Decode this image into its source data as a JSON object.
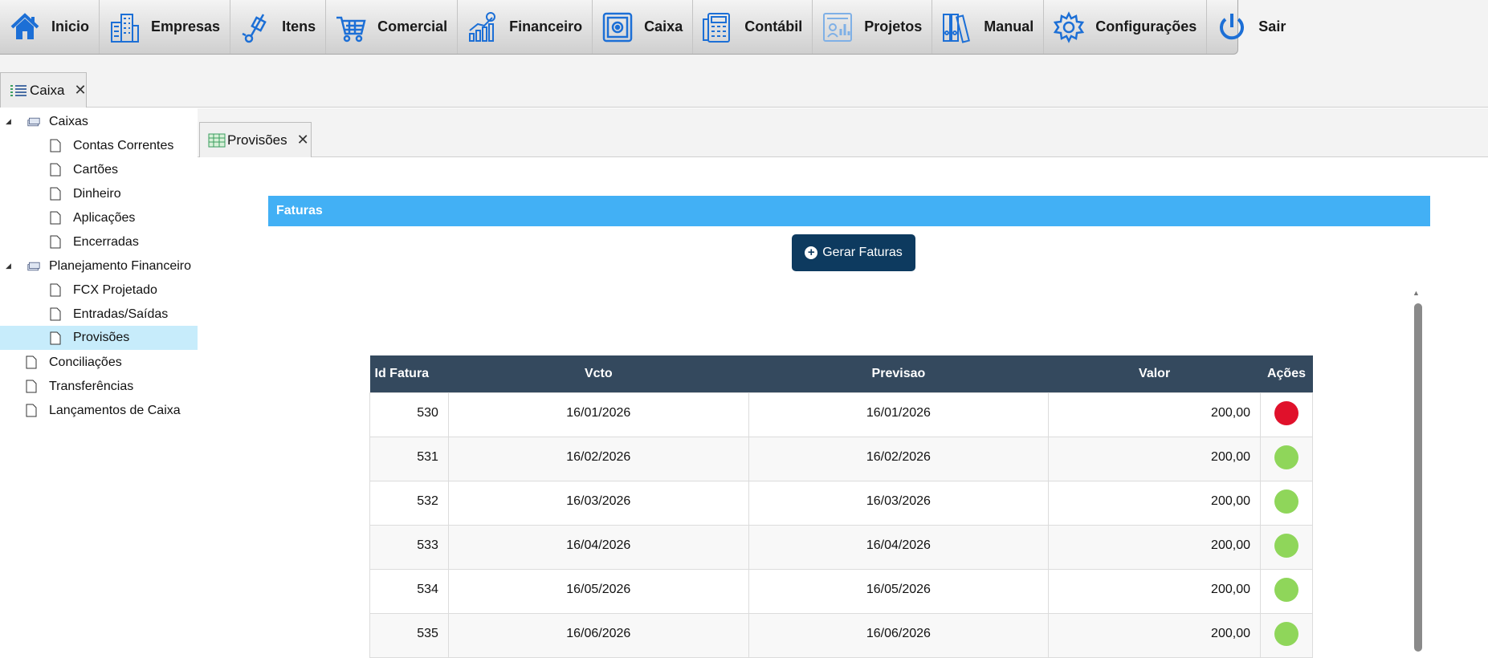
{
  "menu": {
    "items": [
      {
        "label": "Inicio",
        "icon": "home-icon"
      },
      {
        "label": "Empresas",
        "icon": "buildings-icon"
      },
      {
        "label": "Itens",
        "icon": "hand-truck-icon"
      },
      {
        "label": "Comercial",
        "icon": "shopping-cart-icon"
      },
      {
        "label": "Financeiro",
        "icon": "finance-chart-icon"
      },
      {
        "label": "Caixa",
        "icon": "safe-icon"
      },
      {
        "label": "Contábil",
        "icon": "calculator-icon"
      },
      {
        "label": "Projetos",
        "icon": "project-board-icon"
      },
      {
        "label": "Manual",
        "icon": "binders-icon"
      },
      {
        "label": "Configurações",
        "icon": "gear-icon"
      },
      {
        "label": "Sair",
        "icon": "power-icon"
      }
    ]
  },
  "outer_tab": {
    "label": "Caixa"
  },
  "tree": {
    "caixas": "Caixas",
    "contas_correntes": "Contas Correntes",
    "cartoes": "Cartões",
    "dinheiro": "Dinheiro",
    "aplicacoes": "Aplicações",
    "encerradas": "Encerradas",
    "planejamento": "Planejamento Financeiro",
    "fcx": "FCX Projetado",
    "entradas": "Entradas/Saídas",
    "provisoes": "Provisões",
    "conciliacoes": "Conciliações",
    "transferencias": "Transferências",
    "lancamentos": "Lançamentos de Caixa"
  },
  "inner_tab": {
    "label": "Provisões"
  },
  "faturas": {
    "title": "Faturas",
    "button": "Gerar Faturas",
    "columns": [
      "Id Fatura",
      "Vcto",
      "Previsao",
      "Valor",
      "Ações"
    ],
    "rows": [
      {
        "id": "530",
        "vcto": "16/01/2026",
        "previsao": "16/01/2026",
        "valor": "200,00",
        "status": "red"
      },
      {
        "id": "531",
        "vcto": "16/02/2026",
        "previsao": "16/02/2026",
        "valor": "200,00",
        "status": "green"
      },
      {
        "id": "532",
        "vcto": "16/03/2026",
        "previsao": "16/03/2026",
        "valor": "200,00",
        "status": "green"
      },
      {
        "id": "533",
        "vcto": "16/04/2026",
        "previsao": "16/04/2026",
        "valor": "200,00",
        "status": "green"
      },
      {
        "id": "534",
        "vcto": "16/05/2026",
        "previsao": "16/05/2026",
        "valor": "200,00",
        "status": "green"
      },
      {
        "id": "535",
        "vcto": "16/06/2026",
        "previsao": "16/06/2026",
        "valor": "200,00",
        "status": "green"
      }
    ]
  },
  "colors": {
    "accent": "#42b0f5",
    "header": "#34495e",
    "button": "#0d3a5f",
    "red": "#e0112b",
    "green": "#8fd65a",
    "icon_blue": "#1c6fd6"
  }
}
